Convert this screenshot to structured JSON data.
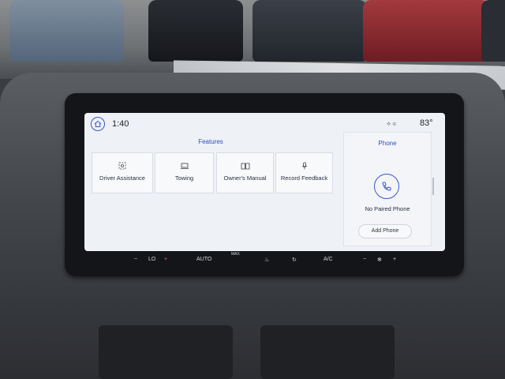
{
  "status": {
    "time": "1:40",
    "temperature": "83°"
  },
  "features": {
    "title": "Features",
    "tiles": [
      {
        "label": "Driver Assistance",
        "icon": "driver-assist-icon"
      },
      {
        "label": "Towing",
        "icon": "towing-icon"
      },
      {
        "label": "Owner's Manual",
        "icon": "book-icon"
      },
      {
        "label": "Record Feedback",
        "icon": "microphone-icon"
      }
    ]
  },
  "phone": {
    "title": "Phone",
    "status": "No Paired Phone",
    "add_label": "Add Phone"
  },
  "climate": {
    "fan_level": "LO",
    "auto": "AUTO",
    "max": "MAX",
    "ac": "A/C",
    "minus": "−",
    "plus": "+"
  },
  "colors": {
    "accent": "#2f4fbf",
    "screen_bg": "#eef1f6"
  }
}
